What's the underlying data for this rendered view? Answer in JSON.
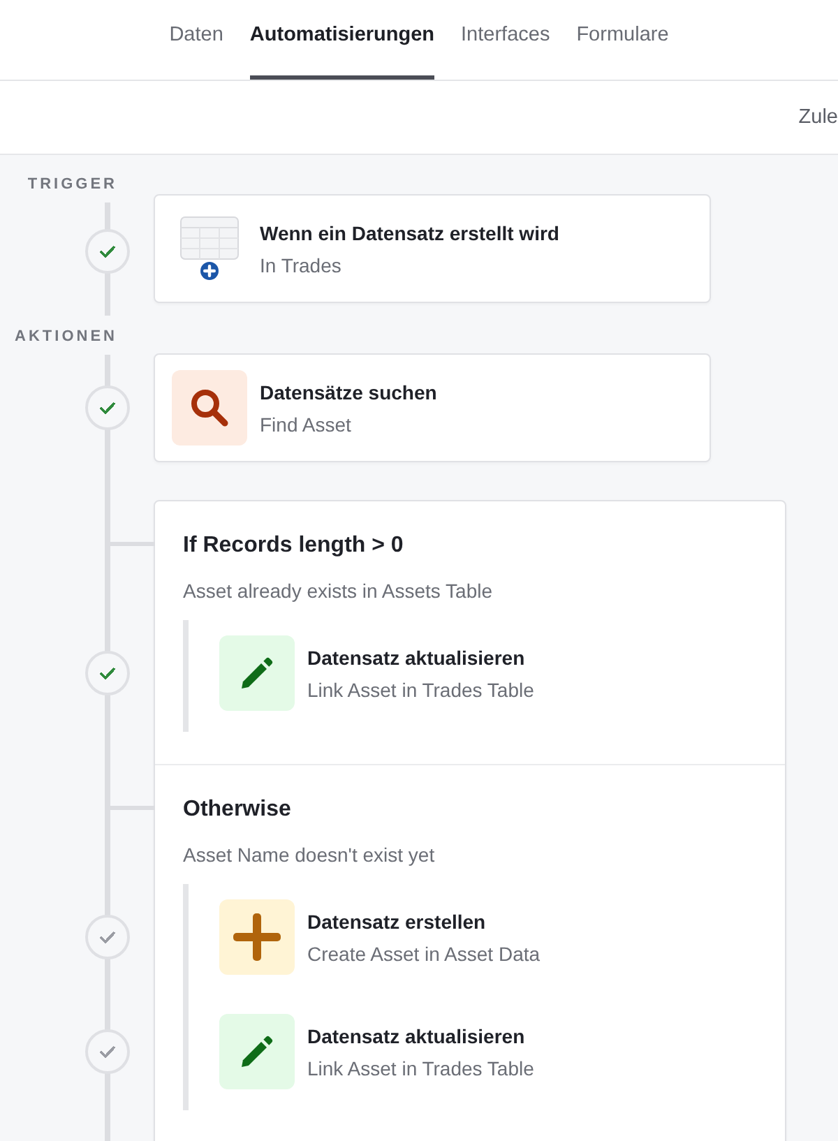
{
  "tabs": [
    {
      "label": "Daten",
      "selected": false
    },
    {
      "label": "Automatisierungen",
      "selected": true
    },
    {
      "label": "Interfaces",
      "selected": false
    },
    {
      "label": "Formulare",
      "selected": false
    }
  ],
  "toolbar": {
    "text": "Zule"
  },
  "trigger": {
    "section_label": "TRIGGER",
    "step": {
      "kind": "record_created",
      "title": "Wenn ein Datensatz erstellt wird",
      "subtitle": "In Trades",
      "color": "#2f8a3c"
    }
  },
  "actions": {
    "section_label": "AKTIONEN",
    "steps": [
      {
        "kind": "find",
        "title": "Datensätze suchen",
        "subtitle": "Find Asset",
        "color": "#2f8a3c"
      },
      {
        "kind": "condition",
        "branches": [
          {
            "heading": "If Records length > 0",
            "description": "Asset already exists in Assets Table",
            "steps": [
              {
                "kind": "update",
                "title": "Datensatz aktualisieren",
                "subtitle": "Link Asset in Trades Table",
                "color": "#2f8a3c"
              }
            ]
          },
          {
            "heading": "Otherwise",
            "description": "Asset Name doesn't exist yet",
            "steps": [
              {
                "kind": "create",
                "title": "Datensatz erstellen",
                "subtitle": "Create Asset in Asset Data",
                "color": "#9a9ca3"
              },
              {
                "kind": "update",
                "title": "Datensatz aktualisieren",
                "subtitle": "Link Asset in Trades Table",
                "color": "#9a9ca3"
              }
            ]
          }
        ]
      }
    ]
  }
}
